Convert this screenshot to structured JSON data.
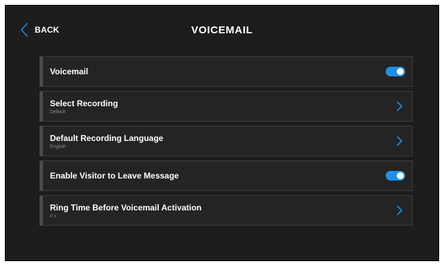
{
  "header": {
    "back_label": "BACK",
    "title": "VOICEMAIL"
  },
  "rows": [
    {
      "label": "Voicemail",
      "sub": "",
      "control": "toggle",
      "state": "on"
    },
    {
      "label": "Select Recording",
      "sub": "Default",
      "control": "chevron"
    },
    {
      "label": "Default Recording Language",
      "sub": "English",
      "control": "chevron"
    },
    {
      "label": "Enable Visitor to Leave Message",
      "sub": "",
      "control": "toggle",
      "state": "on"
    },
    {
      "label": "Ring Time Before Voicemail Activation",
      "sub": "0 s",
      "control": "chevron"
    }
  ],
  "colors": {
    "accent": "#1e90e8",
    "background": "#1d1d1d",
    "row_background": "#242424"
  }
}
